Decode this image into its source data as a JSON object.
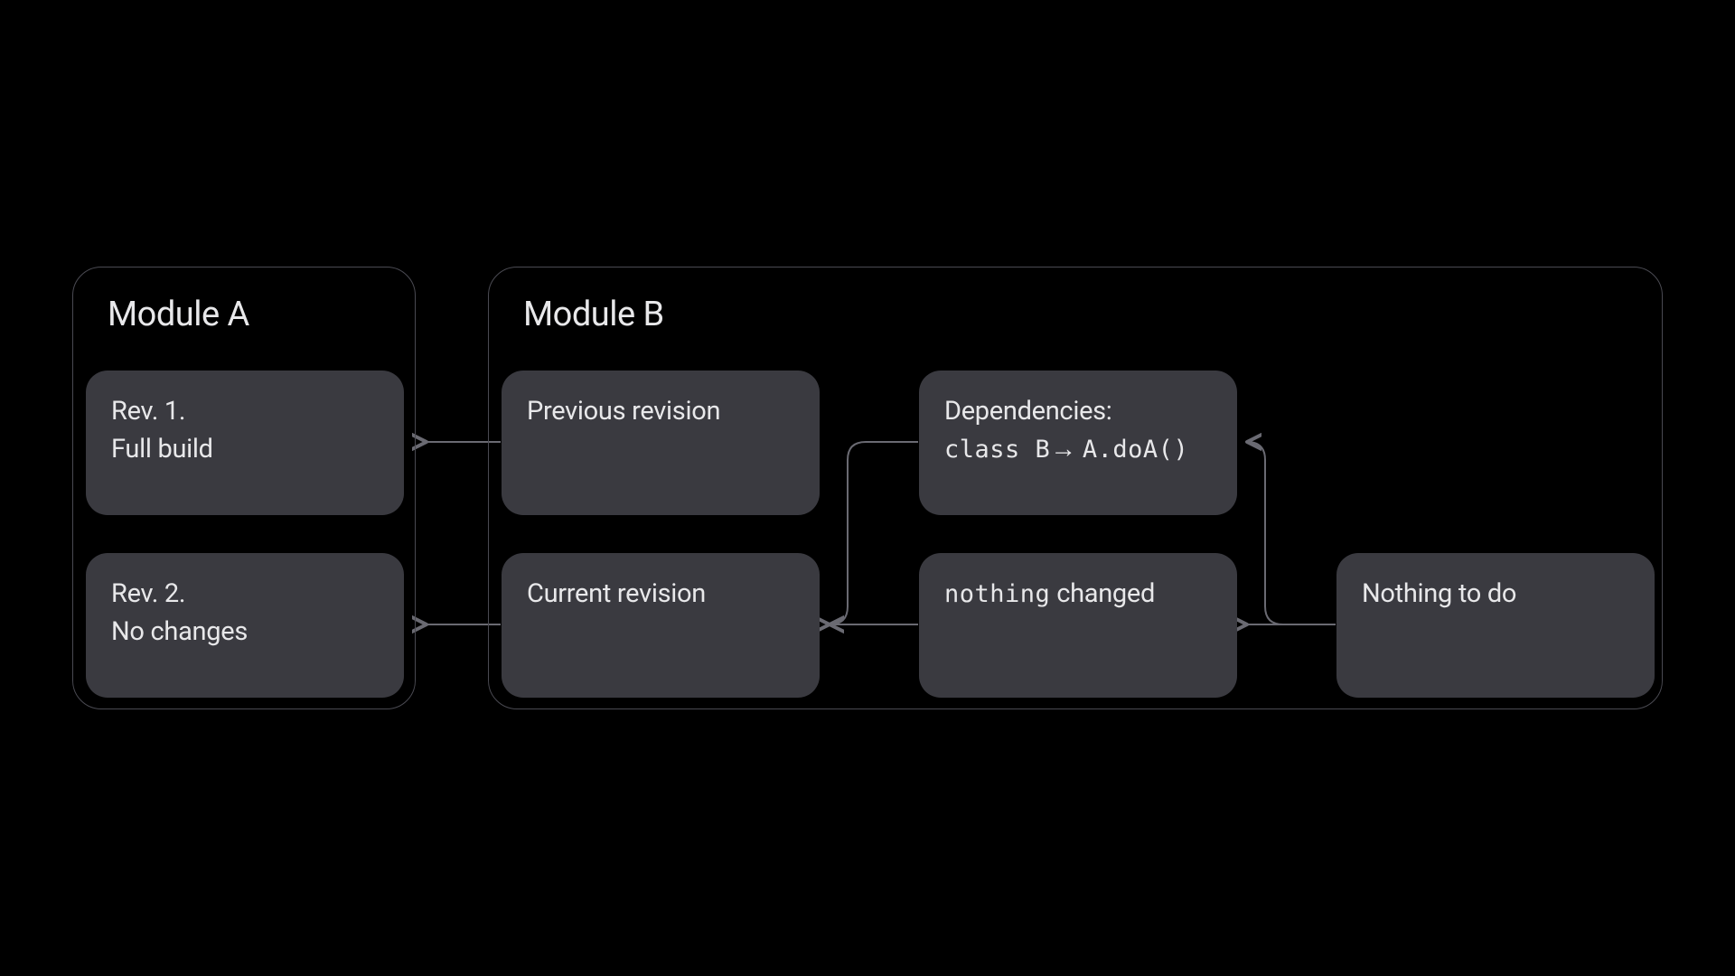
{
  "moduleA": {
    "title": "Module A",
    "box1_line1": "Rev. 1.",
    "box1_line2": "Full build",
    "box2_line1": "Rev. 2.",
    "box2_line2": "No changes"
  },
  "moduleB": {
    "title": "Module B",
    "box1": "Previous revision",
    "box2": "Current revision",
    "box3_line1": "Dependencies:",
    "box3_mono1": "class B",
    "box3_arrow": "→",
    "box3_mono2": "A.doA()",
    "box4_mono": "nothing",
    "box4_rest": " changed",
    "box5": "Nothing to do"
  }
}
